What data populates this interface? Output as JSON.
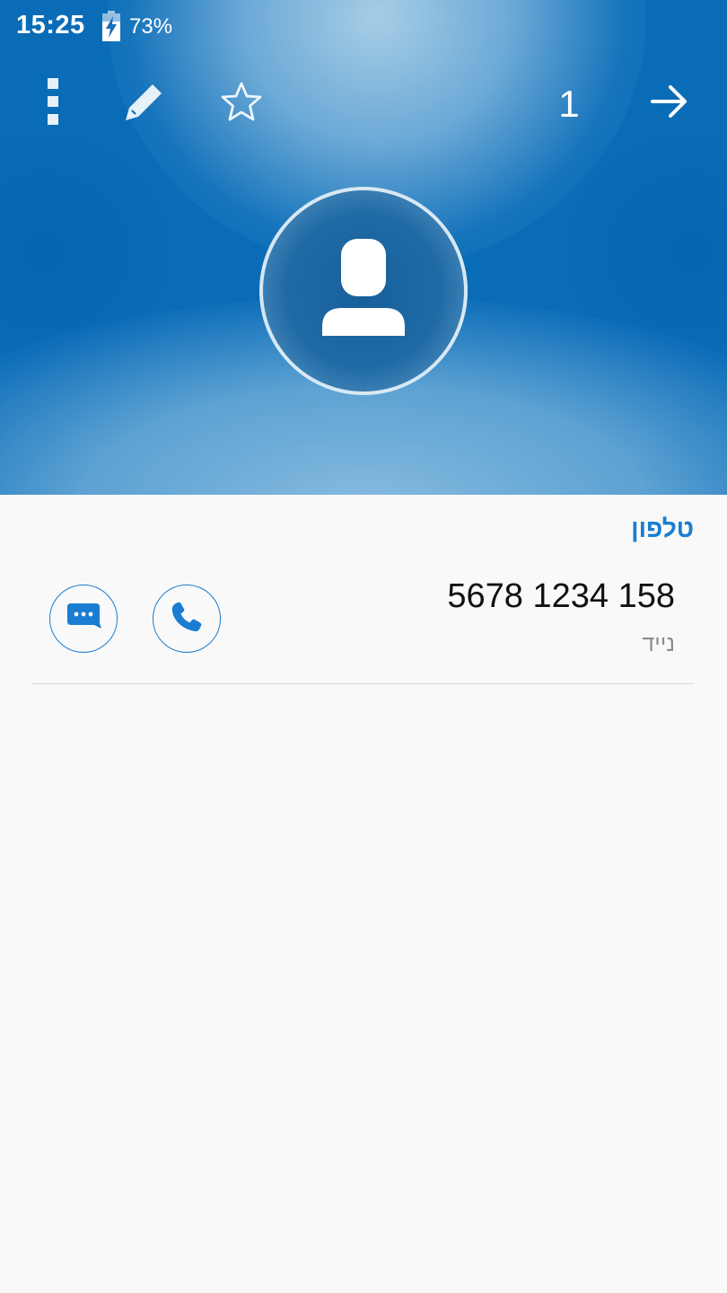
{
  "status_bar": {
    "time": "15:25",
    "battery_percent": "73%",
    "battery_icon": "battery-charging-icon"
  },
  "toolbar": {
    "menu_icon": "more-vertical-icon",
    "edit_icon": "pencil-icon",
    "favorite_icon": "star-outline-icon",
    "counter": "1",
    "forward_icon": "arrow-right-icon"
  },
  "contact": {
    "avatar_icon": "person-placeholder-icon"
  },
  "phone_section": {
    "title": "טלפון",
    "number": "5678 1234 158",
    "type_label": "נייד",
    "message_icon": "message-bubble-icon",
    "call_icon": "phone-icon"
  },
  "colors": {
    "header_blue": "#0a6cb7",
    "accent_blue": "#1a7dd1",
    "background": "#f9f9f9"
  }
}
